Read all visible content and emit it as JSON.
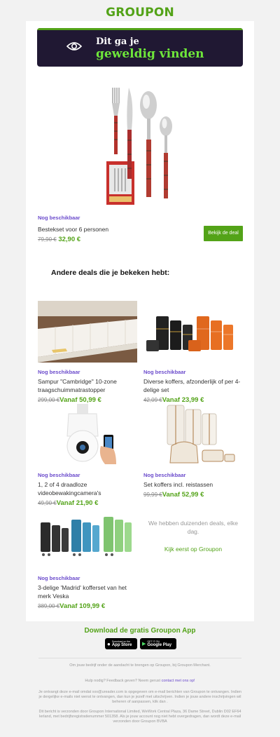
{
  "brand": {
    "logo": "GROUPON",
    "green": "#53a318",
    "purple": "#6b4bcc",
    "hero_bg": "#201833"
  },
  "hero": {
    "line1": "Dit ga je",
    "line2": "geweldig vinden",
    "icon": "eye-icon"
  },
  "main_deal": {
    "availability": "Nog beschikbaar",
    "title": "Bestekset voor 6 personen",
    "old_price": "79,90 €",
    "new_price": "32,90 €",
    "button": "Bekijk de deal"
  },
  "section_title": "Andere deals die je bekeken hebt:",
  "deals": [
    {
      "availability": "Nog beschikbaar",
      "title": "Sampur \"Cambridge\" 10-zone traagschuimmatrastopper",
      "old_price": "299,00 €",
      "new_price": "Vanaf 50,99 €"
    },
    {
      "availability": "Nog beschikbaar",
      "title": "Diverse koffers, afzonderlijk of per 4-delige set",
      "old_price": "42,09 €",
      "new_price": "Vanaf 23,99 €"
    },
    {
      "availability": "Nog beschikbaar",
      "title": "1, 2 of 4 draadloze videobewakingcamera's",
      "old_price": "49,90 €",
      "new_price": "Vanaf 21,90 €"
    },
    {
      "availability": "Nog beschikbaar",
      "title": "Set koffers incl. reistassen",
      "old_price": "99,99 €",
      "new_price": "Vanaf 52,99 €"
    },
    {
      "availability": "Nog beschikbaar",
      "title": "3-delige 'Madrid' kofferset van het merk Veska",
      "old_price": "389,00 €",
      "new_price": "Vanaf 109,99 €"
    }
  ],
  "more": {
    "text": "We hebben duizenden deals, elke dag.",
    "link": "Kijk eerst op Groupon"
  },
  "app": {
    "title": "Download de gratis Groupon App",
    "appstore_small": "Download on the",
    "appstore": "App Store",
    "googleplay_small": "GET IT ON",
    "googleplay": "Google Play"
  },
  "footer": {
    "line1": "Om jouw bedrijf onder de aandacht te brengen op Groupon, bij Groupon Merchant.",
    "help": "Hulp nodig? Feedback geven? Neem gerust",
    "help_link": "contact met ons op!",
    "email_text": "Je ontvangt deze e-mail omdat xxx@ureader.com is opgegeven om e-mail berichten van Groupon te ontvangen. Indien je dergelijke e-mails niet wenst te ontvangen, dan kun je jezelf met uitschrijven. Indien je jouw andere inschrijvingen wil beheren of aanpassen, klik dan .",
    "company": "Dit bericht is verzonden door Groupon International Limited, WeWork Central Plaza, 36 Dame Street, Dublin D02 EF64 Ierland, met bedrijfsregistratienummer 501358. Als je jouw account nog niet hebt overgedragen, dan wordt deze e-mail verzonden door Groupon BVBA"
  }
}
